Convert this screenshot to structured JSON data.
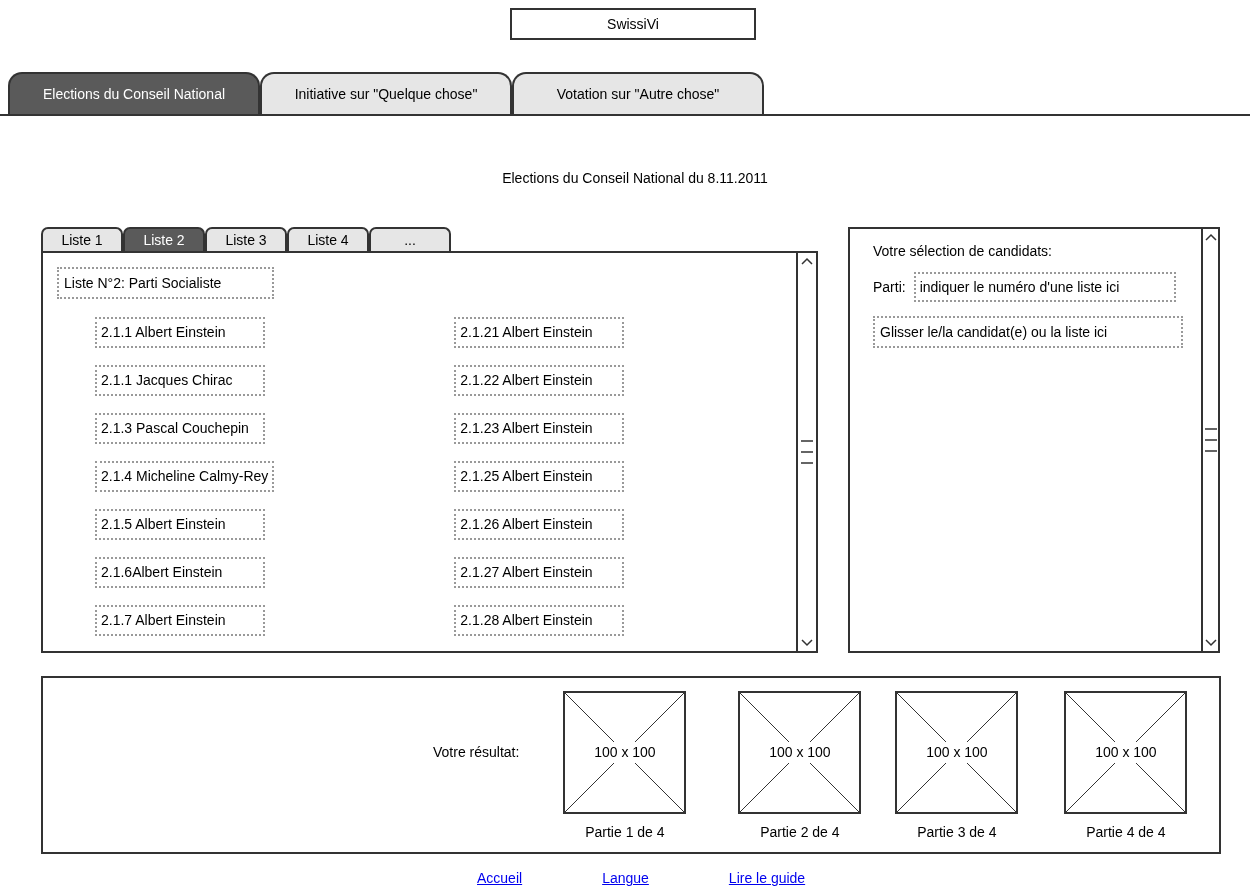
{
  "app_title": "SwissiVi",
  "tabs": [
    {
      "label": "Elections du Conseil National",
      "selected": true
    },
    {
      "label": "Initiative sur \"Quelque chose\"",
      "selected": false
    },
    {
      "label": "Votation sur \"Autre chose\"",
      "selected": false
    }
  ],
  "heading": "Elections du Conseil National du 8.11.2011",
  "list_tabs": [
    {
      "label": "Liste 1",
      "selected": false
    },
    {
      "label": "Liste 2",
      "selected": true
    },
    {
      "label": "Liste 3",
      "selected": false
    },
    {
      "label": "Liste 4",
      "selected": false
    },
    {
      "label": "...",
      "selected": false
    }
  ],
  "list_panel": {
    "title": "Liste N°2: Parti Socialiste",
    "candidates_left": [
      "2.1.1 Albert Einstein",
      "2.1.1 Jacques Chirac",
      "2.1.3 Pascal Couchepin",
      "2.1.4 Micheline Calmy-Rey",
      "2.1.5 Albert Einstein",
      "2.1.6Albert Einstein",
      "2.1.7 Albert Einstein"
    ],
    "candidates_right": [
      "2.1.21 Albert Einstein",
      "2.1.22 Albert Einstein",
      "2.1.23 Albert Einstein",
      "2.1.25 Albert Einstein",
      "2.1.26 Albert Einstein",
      "2.1.27 Albert Einstein",
      "2.1.28 Albert Einstein"
    ]
  },
  "selection_panel": {
    "title": "Votre sélection de candidats:",
    "party_label": "Parti:",
    "party_placeholder": "indiquer le numéro d'une liste ici",
    "drop_zone": "Glisser le/la candidat(e) ou la liste ici"
  },
  "result": {
    "label": "Votre résultat:",
    "parts": [
      {
        "image_label": "100 x 100",
        "caption": "Partie 1 de 4"
      },
      {
        "image_label": "100 x 100",
        "caption": "Partie 2 de 4"
      },
      {
        "image_label": "100 x 100",
        "caption": "Partie 3 de 4"
      },
      {
        "image_label": "100 x 100",
        "caption": "Partie 4 de 4"
      }
    ]
  },
  "links": [
    "Accueil",
    "Langue",
    "Lire le guide"
  ]
}
